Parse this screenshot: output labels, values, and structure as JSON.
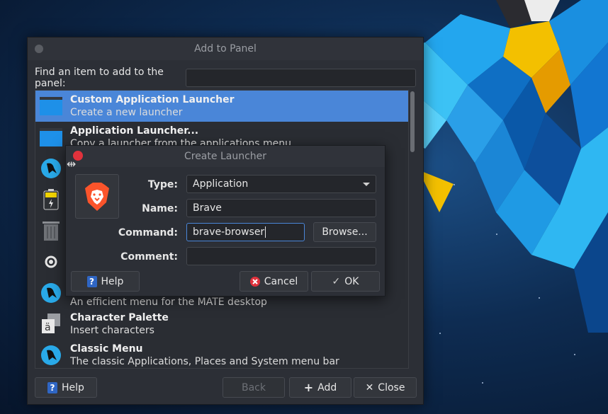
{
  "add_panel": {
    "title": "Add to Panel",
    "find_label": "Find an item to add to the panel:",
    "find_value": "",
    "items": [
      {
        "title": "Custom Application Launcher",
        "desc": "Create a new launcher",
        "icon": "launcher-window-icon",
        "selected": true
      },
      {
        "title": "Application Launcher...",
        "desc": "Copy a launcher from the applications menu",
        "icon": "launcher-window-icon"
      },
      {
        "title": "",
        "desc": "",
        "icon": "penguin-icon"
      },
      {
        "title": "",
        "desc": "",
        "icon": "battery-icon"
      },
      {
        "title": "",
        "desc": "",
        "icon": "trash-icon"
      },
      {
        "title": "",
        "desc": "",
        "icon": "brightness-icon"
      },
      {
        "title": "",
        "desc": "An efficient menu for the MATE desktop",
        "icon": "penguin-icon"
      },
      {
        "title": "Character Palette",
        "desc": "Insert characters",
        "icon": "character-palette-icon"
      },
      {
        "title": "Classic Menu",
        "desc": "The classic Applications, Places and System menu bar",
        "icon": "penguin-icon"
      }
    ],
    "help_label": "Help",
    "back_label": "Back",
    "add_label": "Add",
    "close_label": "Close"
  },
  "create_launcher": {
    "title": "Create Launcher",
    "type_label": "Type:",
    "type_value": "Application",
    "name_label": "Name:",
    "name_value": "Brave",
    "command_label": "Command:",
    "command_value": "brave-browser",
    "browse_label": "Browse...",
    "comment_label": "Comment:",
    "comment_value": "",
    "help_label": "Help",
    "cancel_label": "Cancel",
    "ok_label": "OK"
  },
  "colors": {
    "selection": "#4a86d8",
    "window_bg": "#2c2f36",
    "close_red": "#e0323c",
    "brave_orange": "#fb542b"
  }
}
